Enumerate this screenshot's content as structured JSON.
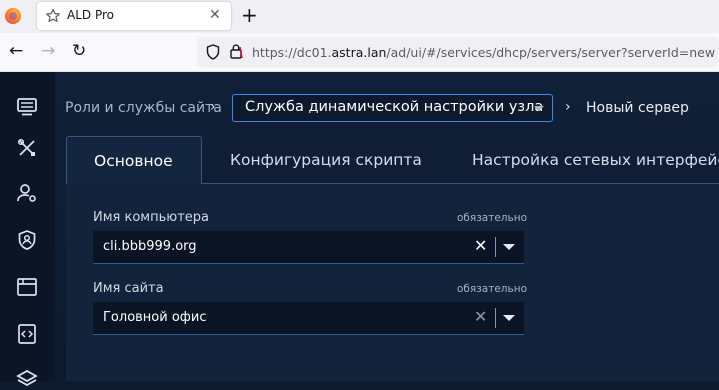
{
  "browser": {
    "tab_title": "ALD Pro",
    "tab_close": "✕",
    "new_tab": "+",
    "back": "←",
    "forward": "→",
    "reload": "↻",
    "url_prefix": "https://dc01.",
    "url_host": "astra.lan",
    "url_path": "/ad/ui/#/services/dhcp/servers/server?serverId=new"
  },
  "breadcrumb": {
    "root": "Роли и службы сайта",
    "separator": "›",
    "service": "Служба динамической настройки узла",
    "current": "Новый сервер"
  },
  "tabs": [
    {
      "label": "Основное",
      "active": true
    },
    {
      "label": "Конфигурация скрипта",
      "active": false
    },
    {
      "label": "Настройка сетевых интерфейсов",
      "active": false
    }
  ],
  "form": {
    "computer_name": {
      "label": "Имя компьютера",
      "required": "обязательно",
      "value": "cli.bbb999.org",
      "clear": "✕"
    },
    "site_name": {
      "label": "Имя сайта",
      "required": "обязательно",
      "value": "Головной офис",
      "clear": "✕"
    }
  },
  "rail_icons": [
    "monitor-icon",
    "tools-icon",
    "user-settings-icon",
    "shield-user-icon",
    "window-icon",
    "code-icon",
    "layers-icon"
  ],
  "colors": {
    "accent": "#3f8ae0",
    "background": "#0e1a2e",
    "panel": "#13233b"
  }
}
